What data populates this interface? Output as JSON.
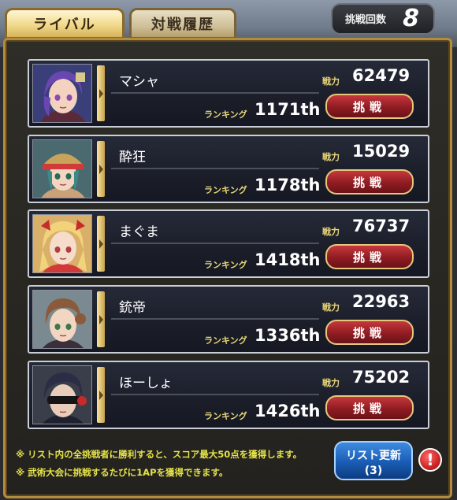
{
  "tabs": {
    "rival": "ライバル",
    "history": "対戦履歴"
  },
  "challenge_count": {
    "label": "挑戦回数",
    "value": "8"
  },
  "labels": {
    "power": "戦力",
    "ranking": "ランキング",
    "challenge": "挑戦"
  },
  "rivals": [
    {
      "name": "マシャ",
      "power": "62479",
      "ranking": "1171th",
      "portrait": "purple-hair-character"
    },
    {
      "name": "酔狂",
      "power": "15029",
      "ranking": "1178th",
      "portrait": "teal-hair-character"
    },
    {
      "name": "まぐま",
      "power": "76737",
      "ranking": "1418th",
      "portrait": "blonde-hair-character"
    },
    {
      "name": "銃帝",
      "power": "22963",
      "ranking": "1336th",
      "portrait": "brown-hair-character"
    },
    {
      "name": "ほーしょ",
      "power": "75202",
      "ranking": "1426th",
      "portrait": "masked-character"
    }
  ],
  "footer": {
    "note1": "※ リスト内の全挑戦者に勝利すると、スコア最大50点を獲得します。",
    "note2": "※ 武術大会に挑戦するたびに1APを獲得できます。",
    "refresh_label": "リスト更新",
    "refresh_count": "(3)",
    "alert": "!"
  },
  "colors": {
    "gold": "#e8d77a",
    "note": "#e3e24a",
    "challenge_button": "#8f1c22",
    "refresh_button": "#1a5cb4"
  }
}
